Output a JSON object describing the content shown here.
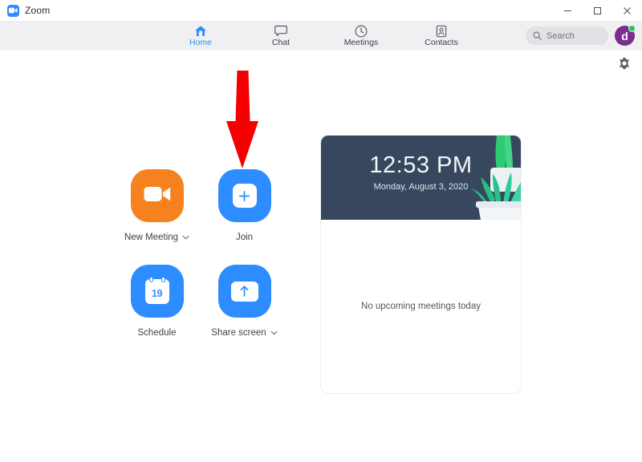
{
  "window": {
    "app_title": "Zoom",
    "logo_icon": "zoom-camera-icon",
    "controls": [
      {
        "name": "minimize",
        "icon": "minimize-icon"
      },
      {
        "name": "maximize",
        "icon": "maximize-icon"
      },
      {
        "name": "close",
        "icon": "close-icon"
      }
    ]
  },
  "toolbar": {
    "tabs": [
      {
        "label": "Home",
        "icon": "home-icon",
        "active": true
      },
      {
        "label": "Chat",
        "icon": "chat-bubble-icon",
        "active": false
      },
      {
        "label": "Meetings",
        "icon": "clock-icon",
        "active": false
      },
      {
        "label": "Contacts",
        "icon": "contact-card-icon",
        "active": false
      }
    ],
    "search": {
      "placeholder": "Search",
      "value": "",
      "icon": "search-icon"
    },
    "avatar": {
      "initial": "d",
      "color": "#7b2d8e",
      "presence": "available",
      "presence_color": "#24c85a"
    },
    "active_color": "#2d8cff"
  },
  "settings": {
    "icon": "gear-icon",
    "label": "Settings"
  },
  "actions": [
    {
      "label": "New Meeting",
      "icon": "video-camera-icon",
      "tile_color": "#f6821f",
      "has_dropdown": true
    },
    {
      "label": "Join",
      "icon": "plus-square-icon",
      "tile_color": "#2d8cff",
      "has_dropdown": false
    },
    {
      "label": "Schedule",
      "icon": "calendar-icon",
      "tile_color": "#2d8cff",
      "has_dropdown": false,
      "calendar_day": "19"
    },
    {
      "label": "Share screen",
      "icon": "share-screen-arrow-icon",
      "tile_color": "#2d8cff",
      "has_dropdown": true
    }
  ],
  "meeting_panel": {
    "time": "12:53 PM",
    "date": "Monday, August 3, 2020",
    "hero_background": "#37485e",
    "decoration_icon": "potted-plant-illustration",
    "empty_state": "No upcoming meetings today"
  },
  "annotation": {
    "icon": "red-down-arrow-annotation",
    "color": "#f40000",
    "points_at": "Join"
  }
}
